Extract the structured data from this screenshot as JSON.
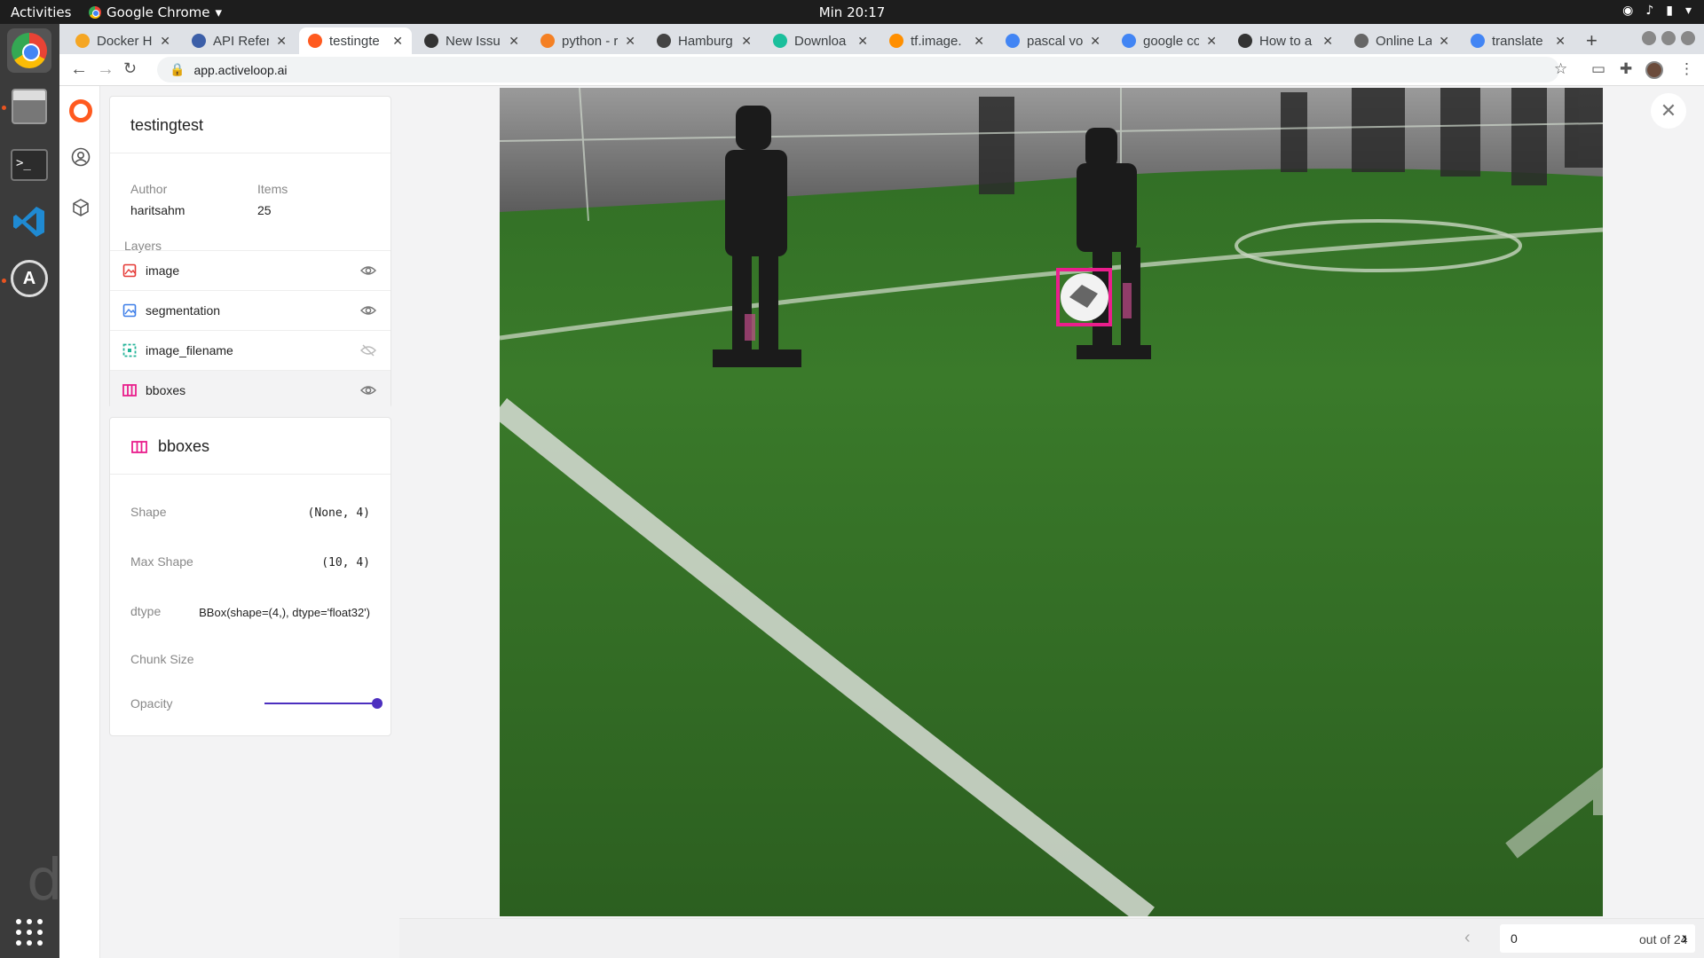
{
  "system": {
    "activities": "Activities",
    "app_name": "Google Chrome",
    "clock": "Min 20:17"
  },
  "browser": {
    "tabs": [
      {
        "label": "Docker H",
        "color": "#f5a623"
      },
      {
        "label": "API Refer",
        "color": "#3c5fa8"
      },
      {
        "label": "testingte",
        "color": "#ff5a1f"
      },
      {
        "label": "New Issu",
        "color": "#333333"
      },
      {
        "label": "python - r",
        "color": "#f48024"
      },
      {
        "label": "Hamburg",
        "color": "#444444"
      },
      {
        "label": "Downloa",
        "color": "#1bbf9c"
      },
      {
        "label": "tf.image.",
        "color": "#ff8f00"
      },
      {
        "label": "pascal vo",
        "color": "#4285f4"
      },
      {
        "label": "google co",
        "color": "#4285f4"
      },
      {
        "label": "How to a",
        "color": "#333333"
      },
      {
        "label": "Online La",
        "color": "#666666"
      },
      {
        "label": "translate",
        "color": "#4285f4"
      }
    ],
    "active_tab": 2,
    "url": "app.activeloop.ai"
  },
  "dataset": {
    "name": "testingtest",
    "author_label": "Author",
    "author": "haritsahm",
    "items_label": "Items",
    "items": "25",
    "layers_label": "Layers",
    "layers": [
      {
        "name": "image",
        "icon": "image-icon",
        "color": "#e53935",
        "visible": true
      },
      {
        "name": "segmentation",
        "icon": "image-icon",
        "color": "#3d7ee8",
        "visible": true
      },
      {
        "name": "image_filename",
        "icon": "text-icon",
        "color": "#26b59a",
        "visible": false
      },
      {
        "name": "bboxes",
        "icon": "bbox-icon",
        "color": "#e91e8c",
        "visible": true
      }
    ]
  },
  "layer_info": {
    "title": "bboxes",
    "shape_label": "Shape",
    "shape": "(None, 4)",
    "max_shape_label": "Max Shape",
    "max_shape": "(10, 4)",
    "dtype_label": "dtype",
    "dtype": "BBox(shape=(4,), dtype='float32')",
    "chunk_label": "Chunk Size",
    "opacity_label": "Opacity",
    "opacity": 1.0
  },
  "pager": {
    "index": "0",
    "total": "out of 24"
  },
  "colors": {
    "accent": "#4c2fbf",
    "brand": "#ff5a1f",
    "bbox": "#ea1e8c"
  }
}
